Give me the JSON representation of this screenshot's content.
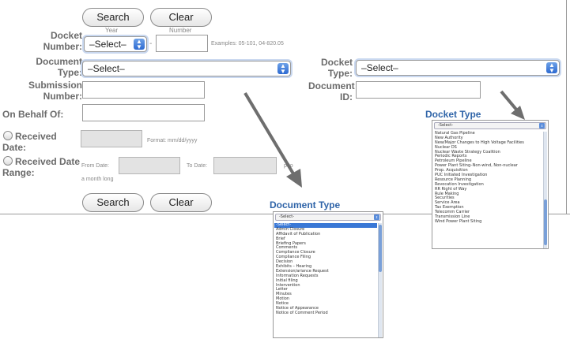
{
  "form": {
    "search_label": "Search",
    "clear_label": "Clear",
    "docket_number": {
      "label": "Docket Number:",
      "year_hint": "Year",
      "number_hint": "Number",
      "select_value": "–Select–",
      "separator": "-",
      "examples": "Examples: 05-101, 04-820.05"
    },
    "document_type": {
      "label": "Document Type:",
      "select_value": "–Select–"
    },
    "submission_number": {
      "label": "Submission Number:"
    },
    "on_behalf_of": {
      "label": "On Behalf Of:"
    },
    "received_date": {
      "label": "Received Date:",
      "format_hint": "Format: mm/dd/yyyy"
    },
    "received_date_range": {
      "label": "Received Date Range:",
      "from_label": "From Date:",
      "to_label": "To Date:",
      "to_suffix": "p to",
      "range_hint": "a month long"
    },
    "docket_type": {
      "label": "Docket Type:",
      "select_value": "–Select–"
    },
    "document_id": {
      "label": "Document ID:"
    }
  },
  "docket_type_popup": {
    "title": "Docket Type",
    "header": "-Select-",
    "items": [
      "Natural Gas Pipeline",
      "New Authority",
      "New/Major Changes to High Voltage Facilities",
      "Nuclear DS",
      "Nuclear Waste Strategy Coalition",
      "Periodic Reports",
      "Petroleum Pipeline",
      "Power Plant Siting–Non-wind, Non-nuclear",
      "Prop. Acquisition",
      "PUC Initiated Investigation",
      "Resource Planning",
      "Revocation Investigation",
      "RR Right of Way",
      "Rule Making",
      "Securities",
      "Service Area",
      "Tax Exemption",
      "Telecomm Carrier",
      "Transmission Line",
      "Wind Power Plant Siting"
    ]
  },
  "document_type_popup": {
    "title": "Document Type",
    "header": "-Select-",
    "items": [
      "-Select-",
      "Admin Closure",
      "Affidavit of Publication",
      "Brief",
      "Briefing Papers",
      "Comments",
      "Compliance Closure",
      "Compliance Filing",
      "Decision",
      "Exhibits – Hearing",
      "Extension/ariance Request",
      "Information Requests",
      "Initial filing",
      "Intervention",
      "Letter",
      "Minutes",
      "Motion",
      "Notice",
      "Notice of Appearance",
      "Notice of Comment Period"
    ],
    "selected_index": 0
  },
  "colors": {
    "label": "#6b6b6b",
    "popup_title": "#2f64a8",
    "selection": "#3a78d6",
    "arrow": "#6e6e6e"
  }
}
